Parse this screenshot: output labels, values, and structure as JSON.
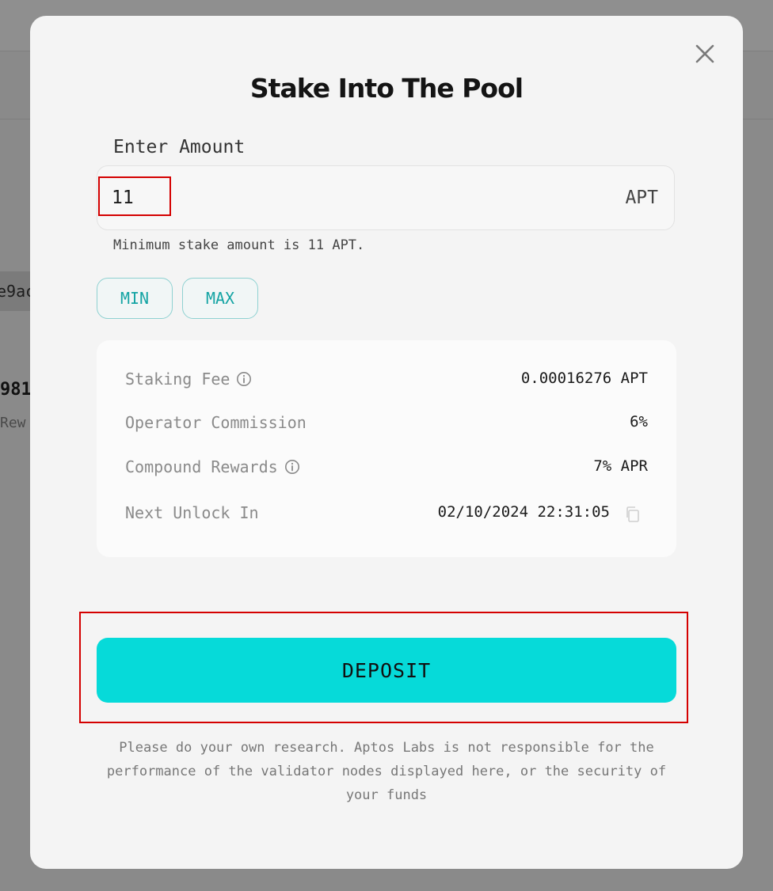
{
  "background": {
    "chip_text": "e9ac",
    "number_text": "981",
    "label_text": "Rew"
  },
  "modal": {
    "title": "Stake Into The Pool",
    "close_icon": "close-icon",
    "amount": {
      "label": "Enter Amount",
      "value": "11",
      "unit": "APT",
      "note": "Minimum stake amount is 11 APT."
    },
    "quick_buttons": {
      "min_label": "MIN",
      "max_label": "MAX"
    },
    "details": [
      {
        "label": "Staking Fee",
        "value": "0.00016276 APT",
        "has_info": true
      },
      {
        "label": "Operator Commission",
        "value": "6%",
        "has_info": false
      },
      {
        "label": "Compound Rewards",
        "value": "7% APR",
        "has_info": true
      },
      {
        "label": "Next Unlock In",
        "value": "02/10/2024 22:31:05",
        "has_copy": true
      }
    ],
    "deposit_label": "DEPOSIT",
    "disclaimer": "Please do your own research. Aptos Labs is not responsible for the performance of the validator nodes displayed here, or the security of your funds"
  },
  "colors": {
    "accent": "#06dad9",
    "pill_text": "#15a4a4",
    "highlight": "#d40000",
    "overlay": "#8a8a8a"
  }
}
